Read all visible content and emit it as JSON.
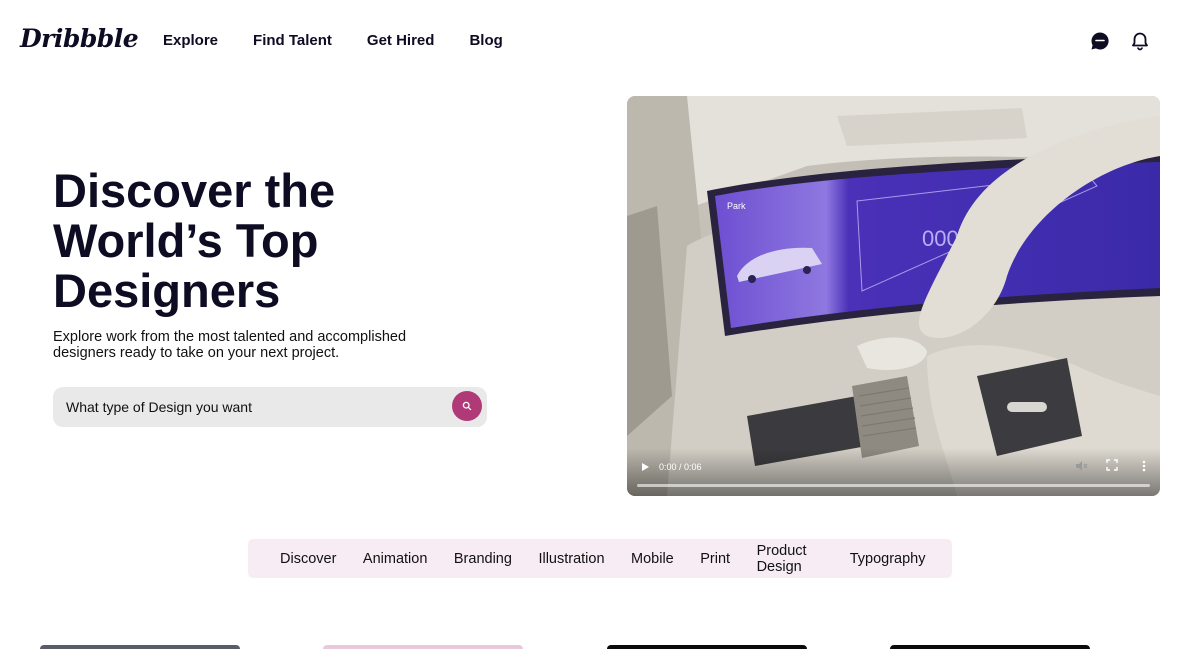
{
  "header": {
    "logo": "Dribbble",
    "nav": [
      "Explore",
      "Find Talent",
      "Get Hired",
      "Blog"
    ],
    "icons": [
      "chat-icon",
      "bell-icon"
    ]
  },
  "hero": {
    "title": "Discover the\nWorld’s Top\nDesigners",
    "subtitle": "Explore work from the most talented and accomplished designers ready to take on your next project.",
    "search": {
      "value": "What type of Design you want"
    }
  },
  "video": {
    "screen_label": "Park",
    "time": "0:00 / 0:06",
    "progress": 0
  },
  "categories": [
    "Discover",
    "Animation",
    "Branding",
    "Illustration",
    "Mobile",
    "Print",
    "Product Design",
    "Typography"
  ],
  "colors": {
    "accent": "#b03a78",
    "category_bar": "#f7ecf3",
    "search_bg": "#e9e9e9"
  }
}
